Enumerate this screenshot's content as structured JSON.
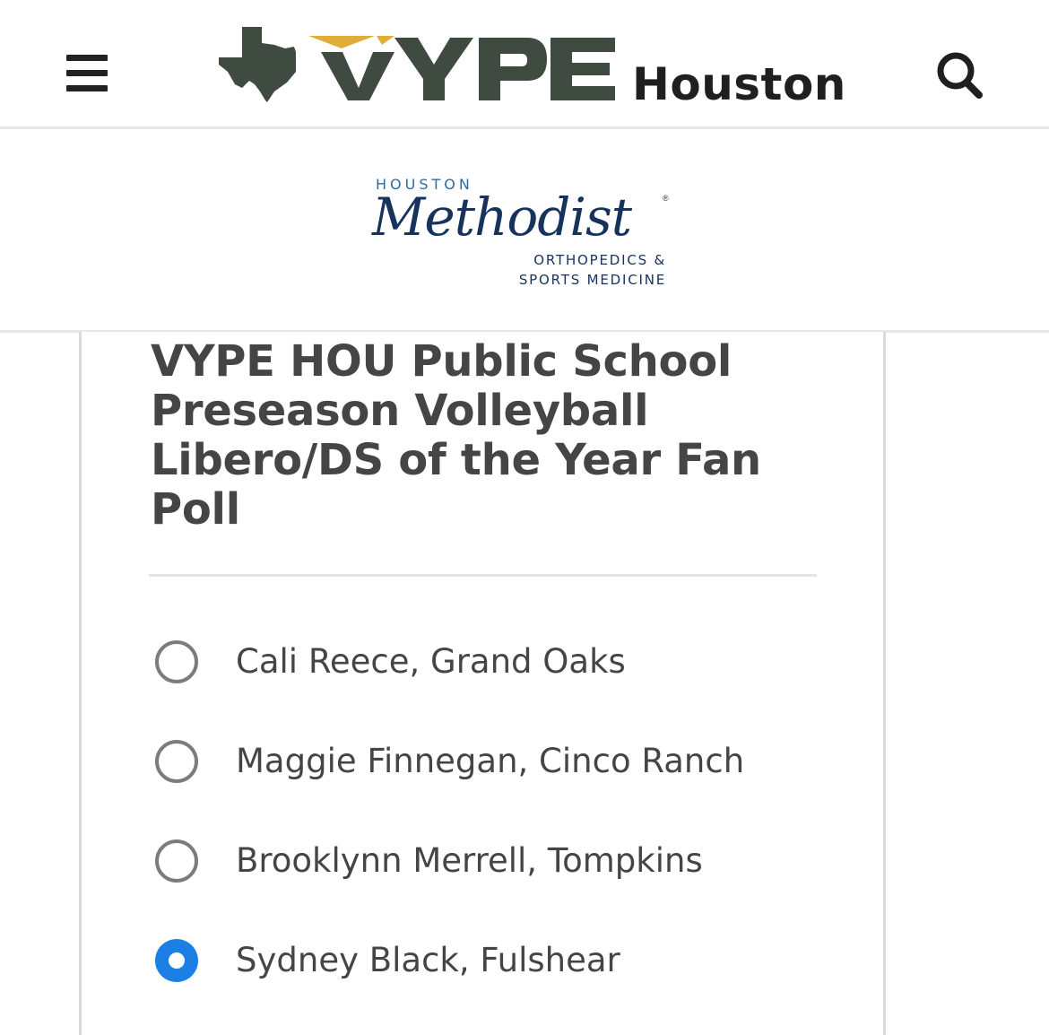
{
  "header": {
    "brand_name": "VYPE",
    "brand_city": "Houston",
    "brand_colors": {
      "text": "#3f4a40",
      "accent": "#e0ad3a"
    },
    "menu_icon": "hamburger-icon",
    "search_icon": "search-icon"
  },
  "sponsor": {
    "top_line": "HOUSTON",
    "name": "Methodist",
    "registered": "®",
    "line1": "ORTHOPEDICS &",
    "line2": "SPORTS MEDICINE",
    "colors": {
      "primary": "#17335c",
      "secondary": "#2e6b9e"
    }
  },
  "poll": {
    "title": "VYPE HOU Public School Preseason Volleyball Libero/DS of the Year Fan Poll",
    "options": [
      {
        "label": "Cali Reece, Grand Oaks",
        "selected": false
      },
      {
        "label": "Maggie Finnegan, Cinco Ranch",
        "selected": false
      },
      {
        "label": "Brooklynn Merrell, Tompkins",
        "selected": false
      },
      {
        "label": "Sydney Black, Fulshear",
        "selected": true
      }
    ],
    "selected_color": "#1b7fe6"
  }
}
